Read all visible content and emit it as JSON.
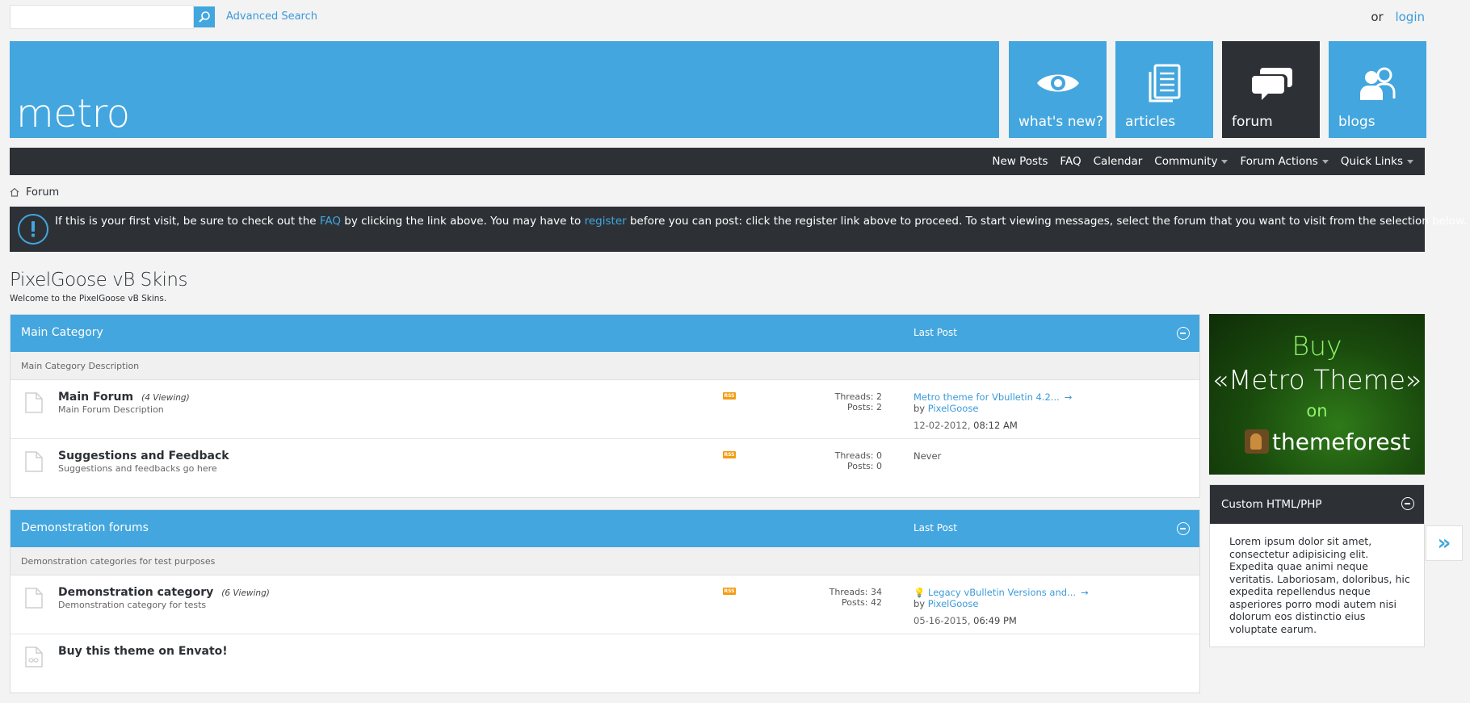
{
  "top": {
    "search_placeholder": "",
    "advanced_search": "Advanced Search",
    "or": "or",
    "login": "login"
  },
  "header": {
    "logo": "metro",
    "tiles": [
      {
        "label": "what's new?",
        "icon": "eye-icon"
      },
      {
        "label": "articles",
        "icon": "document-icon"
      },
      {
        "label": "forum",
        "icon": "chat-bubbles-icon",
        "active": true
      },
      {
        "label": "blogs",
        "icon": "users-icon"
      }
    ]
  },
  "nav": {
    "items": [
      "New Posts",
      "FAQ",
      "Calendar",
      "Community",
      "Forum Actions",
      "Quick Links"
    ]
  },
  "breadcrumb": {
    "label": "Forum"
  },
  "notice": {
    "part1": "If this is your first visit, be sure to check out the ",
    "faq": "FAQ",
    "part2": " by clicking the link above. You may have to ",
    "register": "register",
    "part3": " before you can post: click the register link above to proceed. To start viewing messages, select the forum that you want to visit from the selection below."
  },
  "forum": {
    "title": "PixelGoose vB Skins",
    "subtitle": "Welcome to the PixelGoose vB Skins."
  },
  "categories": [
    {
      "name": "Main Category",
      "last_post_label": "Last Post",
      "description": "Main Category Description",
      "forums": [
        {
          "name": "Main Forum",
          "viewing": "(4 Viewing)",
          "description": "Main Forum Description",
          "threads": "Threads: 2",
          "posts": "Posts: 2",
          "last_post_title": "Metro theme for Vbulletin 4.2...",
          "by": "by",
          "last_post_user": "PixelGoose",
          "last_post_date": "12-02-2012,",
          "last_post_time": "08:12 AM"
        },
        {
          "name": "Suggestions and Feedback",
          "description": "Suggestions and feedbacks go here",
          "threads": "Threads: 0",
          "posts": "Posts: 0",
          "never": "Never"
        }
      ]
    },
    {
      "name": "Demonstration forums",
      "last_post_label": "Last Post",
      "description": "Demonstration categories for test purposes",
      "forums": [
        {
          "name": "Demonstration category",
          "viewing": "(6 Viewing)",
          "description": "Demonstration category for tests",
          "threads": "Threads: 34",
          "posts": "Posts: 42",
          "last_post_title": "Legacy vBulletin Versions and...",
          "by": "by",
          "last_post_user": "PixelGoose",
          "last_post_date": "05-16-2015,",
          "last_post_time": "06:49 PM"
        },
        {
          "name": "Buy this theme on Envato!"
        }
      ]
    }
  ],
  "sidebar": {
    "ad": {
      "buy": "Buy",
      "theme": "«Metro Theme»",
      "on": "on",
      "brand": "themeforest"
    },
    "custom_title": "Custom HTML/PHP",
    "custom_body": "Lorem ipsum dolor sit amet, consectetur adipisicing elit. Expedita quae animi neque veritatis. Laboriosam, doloribus, hic expedita repellendus neque asperiores porro modi autem nisi dolorum eos distinctio eius voluptate earum."
  },
  "colors": {
    "accent": "#43a6de",
    "dark": "#2d3136",
    "rss": "#f39c12"
  }
}
